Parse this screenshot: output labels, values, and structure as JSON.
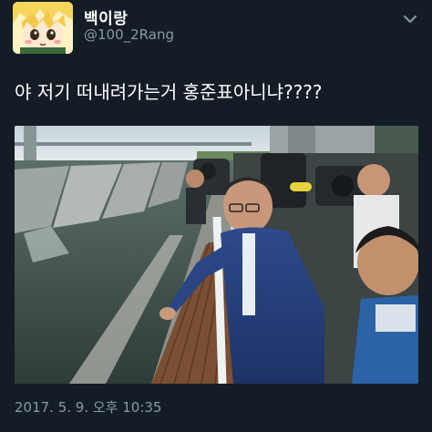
{
  "tweet": {
    "display_name": "백이랑",
    "handle": "@100_2Rang",
    "text": "야 저기 떠내려가는거 홍준표아니냐????",
    "timestamp": "2017. 5. 9. 오후 10:35"
  },
  "icons": {
    "avatar": "anime-avatar",
    "menu": "chevron-down-icon"
  },
  "colors": {
    "background": "#141d26",
    "secondary_text": "#8899a6",
    "primary_text": "#ffffff"
  }
}
